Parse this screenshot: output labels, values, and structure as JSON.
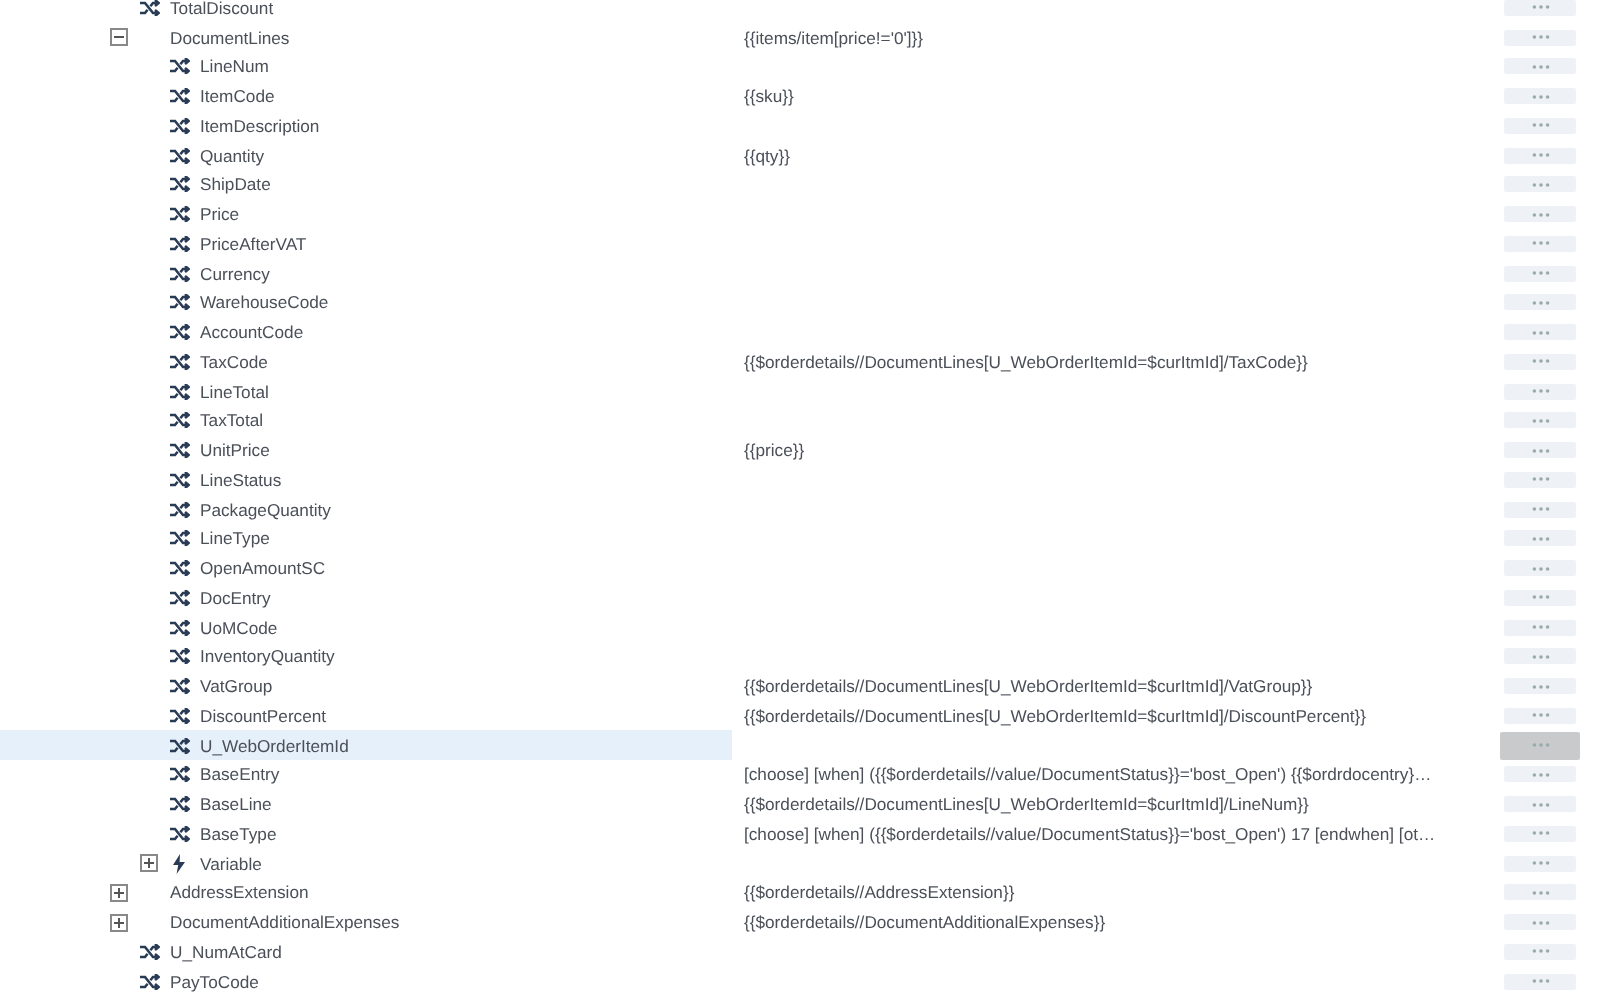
{
  "tree": [
    {
      "kind": "field",
      "name": "TotalDiscount",
      "selected": false
    },
    {
      "kind": "group",
      "name": "DocumentLines",
      "value": "{{items/item[price!='0']}}",
      "expanded": true,
      "selected": false,
      "children": [
        {
          "kind": "field",
          "name": "LineNum",
          "selected": false
        },
        {
          "kind": "field",
          "name": "ItemCode",
          "value": "{{sku}}",
          "selected": false
        },
        {
          "kind": "field",
          "name": "ItemDescription",
          "selected": false
        },
        {
          "kind": "field",
          "name": "Quantity",
          "value": "{{qty}}",
          "selected": false
        },
        {
          "kind": "field",
          "name": "ShipDate",
          "selected": false
        },
        {
          "kind": "field",
          "name": "Price",
          "selected": false
        },
        {
          "kind": "field",
          "name": "PriceAfterVAT",
          "selected": false
        },
        {
          "kind": "field",
          "name": "Currency",
          "selected": false
        },
        {
          "kind": "field",
          "name": "WarehouseCode",
          "selected": false
        },
        {
          "kind": "field",
          "name": "AccountCode",
          "selected": false
        },
        {
          "kind": "field",
          "name": "TaxCode",
          "value": "{{$orderdetails//DocumentLines[U_WebOrderItemId=$curItmId]/TaxCode}}",
          "selected": false
        },
        {
          "kind": "field",
          "name": "LineTotal",
          "selected": false
        },
        {
          "kind": "field",
          "name": "TaxTotal",
          "selected": false
        },
        {
          "kind": "field",
          "name": "UnitPrice",
          "value": "{{price}}",
          "selected": false
        },
        {
          "kind": "field",
          "name": "LineStatus",
          "selected": false
        },
        {
          "kind": "field",
          "name": "PackageQuantity",
          "selected": false
        },
        {
          "kind": "field",
          "name": "LineType",
          "selected": false
        },
        {
          "kind": "field",
          "name": "OpenAmountSC",
          "selected": false
        },
        {
          "kind": "field",
          "name": "DocEntry",
          "selected": false
        },
        {
          "kind": "field",
          "name": "UoMCode",
          "selected": false
        },
        {
          "kind": "field",
          "name": "InventoryQuantity",
          "selected": false
        },
        {
          "kind": "field",
          "name": "VatGroup",
          "value": "{{$orderdetails//DocumentLines[U_WebOrderItemId=$curItmId]/VatGroup}}",
          "selected": false
        },
        {
          "kind": "field",
          "name": "DiscountPercent",
          "value": "{{$orderdetails//DocumentLines[U_WebOrderItemId=$curItmId]/DiscountPercent}}",
          "selected": false
        },
        {
          "kind": "field",
          "name": "U_WebOrderItemId",
          "selected": true
        },
        {
          "kind": "field",
          "name": "BaseEntry",
          "value": "[choose] [when] ({{$orderdetails//value/DocumentStatus}}='bost_Open') {{$ordrdocentry}…",
          "selected": false
        },
        {
          "kind": "field",
          "name": "BaseLine",
          "value": "{{$orderdetails//DocumentLines[U_WebOrderItemId=$curItmId]/LineNum}}",
          "selected": false
        },
        {
          "kind": "field",
          "name": "BaseType",
          "value": "[choose] [when] ({{$orderdetails//value/DocumentStatus}}='bost_Open') 17 [endwhen] [ot…",
          "selected": false
        },
        {
          "kind": "variable",
          "name": "Variable",
          "expanded": false,
          "selected": false
        }
      ]
    },
    {
      "kind": "group",
      "name": "AddressExtension",
      "value": "{{$orderdetails//AddressExtension}}",
      "expanded": false,
      "selected": false
    },
    {
      "kind": "group",
      "name": "DocumentAdditionalExpenses",
      "value": "{{$orderdetails//DocumentAdditionalExpenses}}",
      "expanded": false,
      "selected": false
    },
    {
      "kind": "field",
      "name": "U_NumAtCard",
      "selected": false
    },
    {
      "kind": "field",
      "name": "PayToCode",
      "selected": false
    }
  ]
}
